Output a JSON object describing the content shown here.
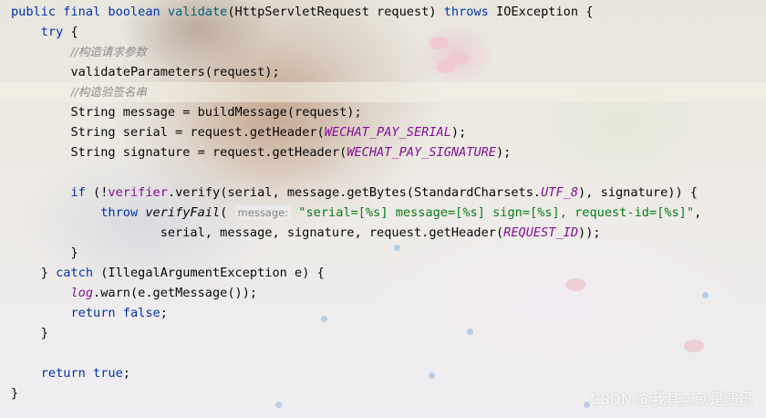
{
  "code": {
    "l1": {
      "kw1": "public",
      "kw2": "final",
      "kw3": "boolean",
      "method": "validate",
      "sig": "(HttpServletRequest request) ",
      "kw4": "throws",
      "rest": " IOException {"
    },
    "l2": {
      "kw": "try",
      "rest": " {"
    },
    "l3": {
      "comment": "//构造请求参数"
    },
    "l4": {
      "text": "validateParameters(request);"
    },
    "l5": {
      "comment": "//构造验签名串"
    },
    "l6": {
      "text": "String message = buildMessage(request);"
    },
    "l7": {
      "pre": "String serial = request.getHeader(",
      "const": "WECHAT_PAY_SERIAL",
      "post": ");"
    },
    "l8": {
      "pre": "String signature = request.getHeader(",
      "const": "WECHAT_PAY_SIGNATURE",
      "post": ");"
    },
    "l10": {
      "kw": "if",
      "a": " (!",
      "field": "verifier",
      "b": ".verify(serial, message.getBytes(StandardCharsets.",
      "const": "UTF_8",
      "c": "), signature)) {"
    },
    "l11": {
      "kw": "throw",
      "method": "verifyFail",
      "paren": "(",
      "hint": "message:",
      "str": "\"serial=[%s] message=[%s] sign=[%s], request-id=[%s]\"",
      "comma": ","
    },
    "l12": {
      "pre": "serial, message, signature, request.getHeader(",
      "const": "REQUEST_ID",
      "post": "));"
    },
    "l13": {
      "text": "}"
    },
    "l14": {
      "a": "} ",
      "kw": "catch",
      "b": " (IllegalArgumentException e) {"
    },
    "l15": {
      "field": "log",
      "rest": ".warn(e.getMessage());"
    },
    "l16": {
      "kw1": "return",
      "kw2": "false",
      "rest": ";"
    },
    "l17": {
      "text": "}"
    },
    "l19": {
      "kw1": "return",
      "kw2": "true",
      "rest": ";"
    },
    "l20": {
      "text": "}"
    }
  },
  "watermark": "CSDN @我其实就是演员"
}
